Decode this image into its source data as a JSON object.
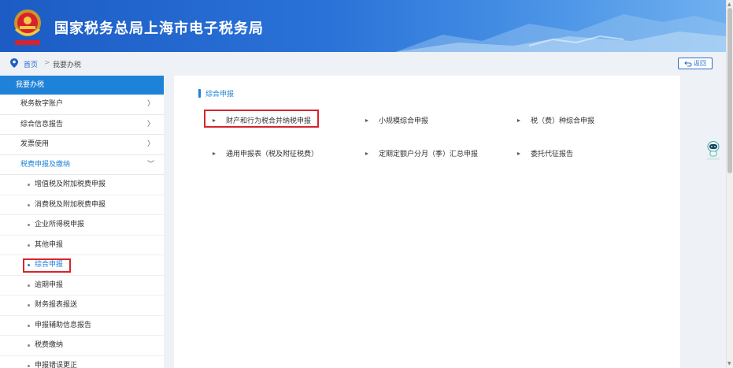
{
  "header": {
    "title": "国家税务总局上海市电子税务局",
    "emblem_icon": "tax-emblem-icon"
  },
  "breadcrumb": {
    "home": "首页",
    "separator": ">",
    "current": "我要办税"
  },
  "back_button": {
    "label": "返回"
  },
  "sidebar": {
    "header": "我要办税",
    "items": [
      {
        "label": "税务数字账户",
        "chevron": "〉"
      },
      {
        "label": "综合信息报告",
        "chevron": "〉"
      },
      {
        "label": "发票使用",
        "chevron": "〉"
      },
      {
        "label": "税费申报及缴纳",
        "chevron": "﹀",
        "expanded": true
      }
    ],
    "sub_items": [
      {
        "label": "增值税及附加税费申报"
      },
      {
        "label": "消费税及附加税费申报"
      },
      {
        "label": "企业所得税申报"
      },
      {
        "label": "其他申报"
      },
      {
        "label": "综合申报",
        "active": true
      },
      {
        "label": "逾期申报"
      },
      {
        "label": "财务报表报送"
      },
      {
        "label": "申报辅助信息报告"
      },
      {
        "label": "税费缴纳"
      },
      {
        "label": "申报错误更正"
      }
    ]
  },
  "main": {
    "section_title": "综合申报",
    "links": [
      {
        "label": "财产和行为税合并纳税申报",
        "highlighted": true
      },
      {
        "label": "小规模综合申报"
      },
      {
        "label": "税（费）种综合申报"
      },
      {
        "label": "通用申报表（税及附征税费）"
      },
      {
        "label": "定期定额户分月（季）汇总申报"
      },
      {
        "label": "委托代征报告"
      }
    ]
  },
  "colors": {
    "accent": "#1e82d8",
    "highlight": "#d9232b",
    "header_start": "#1c5cc4",
    "header_end": "#6fb0ef"
  }
}
